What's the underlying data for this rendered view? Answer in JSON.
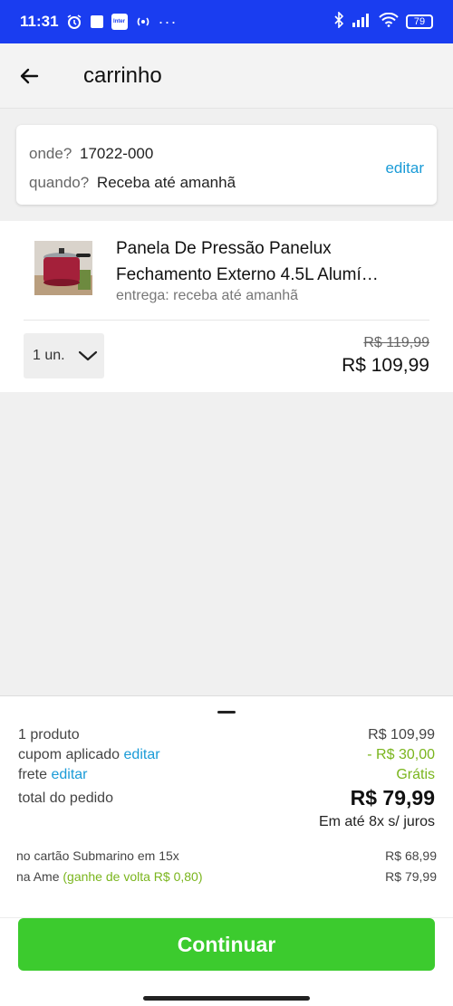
{
  "status_bar": {
    "time": "11:31",
    "battery": "79",
    "icons": [
      "alarm-icon",
      "notification-square-icon",
      "inter-app-icon",
      "nfc-icon",
      "more-dots-icon",
      "bluetooth-icon",
      "signal-icon",
      "wifi-icon",
      "battery-icon"
    ],
    "inter_label": "Inter",
    "more": "···"
  },
  "header": {
    "title": "carrinho",
    "back_icon": "arrow-left-icon"
  },
  "location": {
    "where_label": "onde?",
    "where_value": "17022-000",
    "when_label": "quando?",
    "when_value": "Receba até amanhã",
    "edit_label": "editar"
  },
  "product": {
    "name_line1": "Panela De Pressão Panelux",
    "name_line2": "Fechamento Externo 4.5L Alumí…",
    "delivery": "entrega: receba até amanhã",
    "quantity": "1 un.",
    "old_price": "R$ 119,99",
    "price": "R$ 109,99"
  },
  "summary": {
    "products_label": "1 produto",
    "products_value": "R$ 109,99",
    "coupon_label": "cupom aplicado",
    "coupon_edit": "editar",
    "coupon_value": "- R$ 30,00",
    "shipping_label": "frete",
    "shipping_edit": "editar",
    "shipping_value": "Grátis",
    "total_label": "total do pedido",
    "total_value": "R$ 79,99",
    "installments": "Em até 8x s/ juros",
    "card_label": "no cartão Submarino em 15x",
    "card_value": "R$ 68,99",
    "ame_label": "na Ame",
    "ame_cashback": "(ganhe de volta R$ 0,80)",
    "ame_value": "R$ 79,99"
  },
  "actions": {
    "continue_label": "Continuar"
  },
  "colors": {
    "status_bar": "#1a3df0",
    "link": "#1a9bd7",
    "green_text": "#7ab51d",
    "button": "#3ccb2e"
  }
}
